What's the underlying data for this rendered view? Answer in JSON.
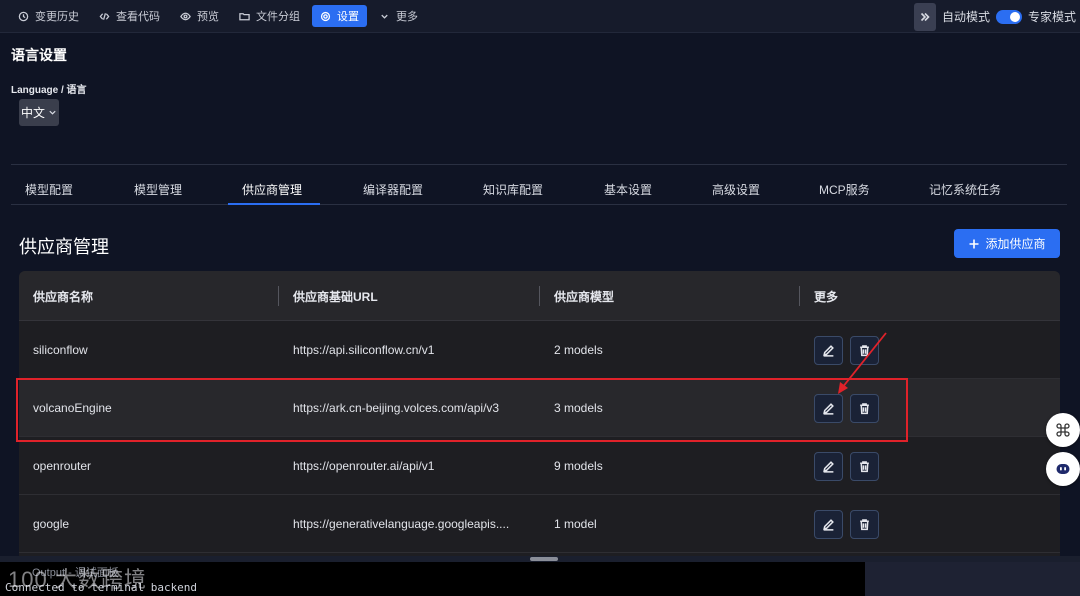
{
  "toolbar": {
    "items": [
      {
        "label": "变更历史",
        "icon": "clock-icon"
      },
      {
        "label": "查看代码",
        "icon": "code-icon"
      },
      {
        "label": "预览",
        "icon": "eye-icon"
      },
      {
        "label": "文件分组",
        "icon": "folder-icon"
      },
      {
        "label": "设置",
        "icon": "gear-icon",
        "active": true
      },
      {
        "label": "更多",
        "icon": "chevron-down-icon"
      }
    ],
    "auto_mode": "自动模式",
    "expert_mode": "专家模式"
  },
  "language": {
    "title": "语言设置",
    "label": "Language / 语言",
    "selected": "中文"
  },
  "tabs": [
    "模型配置",
    "模型管理",
    "供应商管理",
    "编译器配置",
    "知识库配置",
    "基本设置",
    "高级设置",
    "MCP服务",
    "记忆系统任务"
  ],
  "active_tab": "供应商管理",
  "section": {
    "title": "供应商管理",
    "add_button": "添加供应商"
  },
  "table": {
    "headers": [
      "供应商名称",
      "供应商基础URL",
      "供应商模型",
      "更多"
    ],
    "rows": [
      {
        "name": "siliconflow",
        "url": "https://api.siliconflow.cn/v1",
        "models": "2 models"
      },
      {
        "name": "volcanoEngine",
        "url": "https://ark.cn-beijing.volces.com/api/v3",
        "models": "3 models"
      },
      {
        "name": "openrouter",
        "url": "https://openrouter.ai/api/v1",
        "models": "9 models"
      },
      {
        "name": "google",
        "url": "https://generativelanguage.googleapis....",
        "models": "1 model"
      }
    ]
  },
  "terminal": {
    "title": "Output - 调试面板",
    "line": "Connected to terminal backend"
  },
  "watermark": "100 大数跨境",
  "colors": {
    "accent": "#2b6ef2",
    "highlight": "#e0222a",
    "background": "#0f1424"
  }
}
